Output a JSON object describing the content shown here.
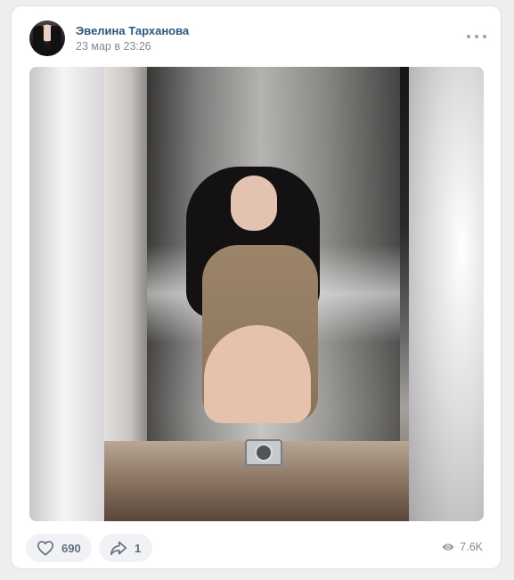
{
  "post": {
    "author": "Эвелина Тарханова",
    "date": "23 мар в 23:26",
    "menu_icon": "more-horizontal-icon",
    "likes": "690",
    "shares": "1",
    "views": "7.6K",
    "like_icon": "heart-icon",
    "share_icon": "share-arrow-icon",
    "views_icon": "eye-icon"
  },
  "colors": {
    "link": "#2a5885",
    "secondary_text": "#818c99",
    "button_bg": "#f0f2f5",
    "page_bg": "#edeef0"
  }
}
